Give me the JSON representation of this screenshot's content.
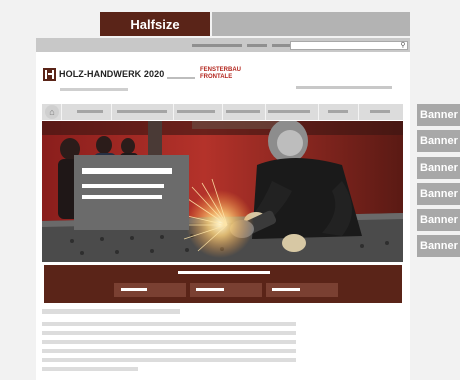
{
  "tabs": {
    "halfsize_label": "Halfsize"
  },
  "utility": {
    "search_icon": "search-icon"
  },
  "header": {
    "logo_text": "HOLZ-HANDWERK 2020",
    "partner_logo_line1": "FENSTERBAU",
    "partner_logo_line2": "FRONTALE"
  },
  "hero": {
    "image": "welder-grinding-metal-sparks"
  },
  "banners": [
    "Banner",
    "Banner",
    "Banner",
    "Banner",
    "Banner",
    "Banner"
  ],
  "colors": {
    "brand": "#5a2418",
    "banner": "#a8a8a8",
    "partner_red": "#b3261e"
  }
}
